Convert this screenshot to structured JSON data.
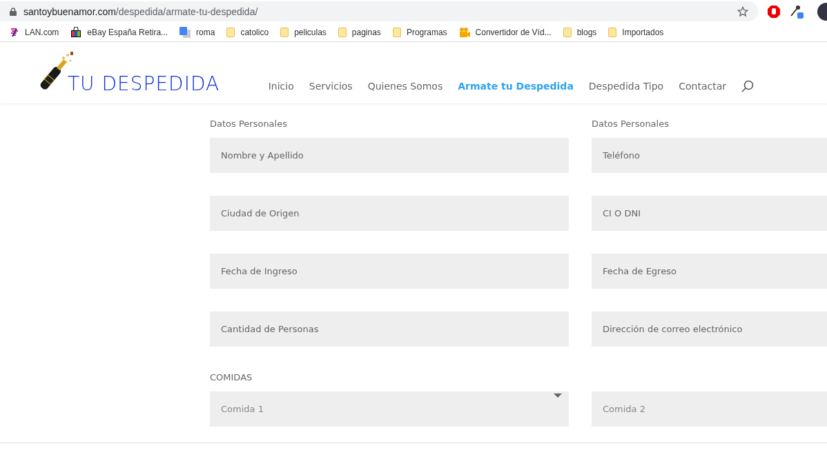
{
  "browser": {
    "url_host": "santoybuenamor.com",
    "url_path": "/despedida/armate-tu-despedida/"
  },
  "bookmarks": [
    {
      "label": "LAN.com",
      "kind": "lan"
    },
    {
      "label": "eBay España Retira...",
      "kind": "bag"
    },
    {
      "label": "roma",
      "kind": "translate"
    },
    {
      "label": "catolico",
      "kind": "folder"
    },
    {
      "label": "peliculas",
      "kind": "folder"
    },
    {
      "label": "paginas",
      "kind": "folder"
    },
    {
      "label": "Programas",
      "kind": "folder"
    },
    {
      "label": "Convertidor de Víd...",
      "kind": "camera"
    },
    {
      "label": "blogs",
      "kind": "folder"
    },
    {
      "label": "Importados",
      "kind": "folder"
    }
  ],
  "site": {
    "logo_text": "TU DESPEDIDA",
    "nav": [
      {
        "label": "Inicio",
        "selected": false
      },
      {
        "label": "Servicios",
        "selected": false
      },
      {
        "label": "Quienes Somos",
        "selected": false
      },
      {
        "label": "Armate tu Despedida",
        "selected": true
      },
      {
        "label": "Despedida Tipo",
        "selected": false
      },
      {
        "label": "Contactar",
        "selected": false
      }
    ]
  },
  "form": {
    "left_heading": "Datos Personales",
    "right_heading": "Datos Personales",
    "rows": [
      {
        "left": {
          "placeholder": "Nombre y Apellido"
        },
        "right": {
          "placeholder": "Teléfono"
        }
      },
      {
        "left": {
          "placeholder": "Ciudad de Origen"
        },
        "right": {
          "placeholder": "CI O DNI"
        }
      },
      {
        "left": {
          "placeholder": "Fecha de Ingreso"
        },
        "right": {
          "placeholder": "Fecha de Egreso"
        }
      },
      {
        "left": {
          "placeholder": "Cantidad de Personas"
        },
        "right": {
          "placeholder": "Dirección de correo electrónico"
        }
      }
    ],
    "section_heading": "COMIDAS",
    "selects": [
      {
        "placeholder": "Comida 1",
        "kind": "select"
      },
      {
        "placeholder": "Comida 2",
        "kind": "select"
      }
    ]
  }
}
